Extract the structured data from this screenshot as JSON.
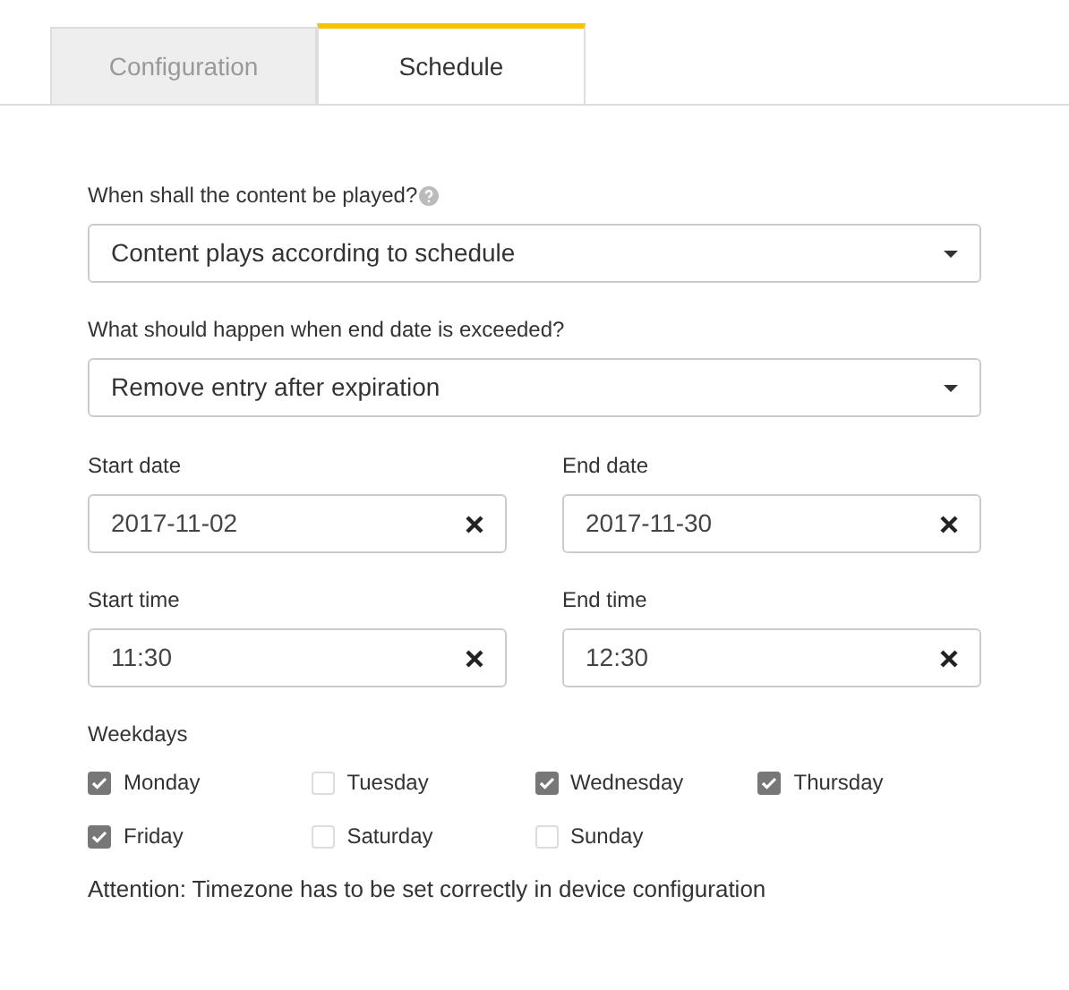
{
  "tabs": [
    {
      "label": "Configuration",
      "selected": false
    },
    {
      "label": "Schedule",
      "selected": true
    }
  ],
  "play_mode": {
    "label": "When shall the content be played?",
    "value": "Content plays according to schedule"
  },
  "expiration": {
    "label": "What should happen when end date is exceeded?",
    "value": "Remove entry after expiration"
  },
  "fields": [
    {
      "label": "Start date",
      "value": "2017-11-02"
    },
    {
      "label": "End date",
      "value": "2017-11-30"
    },
    {
      "label": "Start time",
      "value": "11:30"
    },
    {
      "label": "End time",
      "value": "12:30"
    }
  ],
  "weekdays": {
    "label": "Weekdays",
    "days": [
      {
        "label": "Monday",
        "checked": true
      },
      {
        "label": "Tuesday",
        "checked": false
      },
      {
        "label": "Wednesday",
        "checked": true
      },
      {
        "label": "Thursday",
        "checked": true
      },
      {
        "label": "Friday",
        "checked": true
      },
      {
        "label": "Saturday",
        "checked": false
      },
      {
        "label": "Sunday",
        "checked": false
      }
    ]
  },
  "note": "Attention: Timezone has to be set correctly in device configuration"
}
